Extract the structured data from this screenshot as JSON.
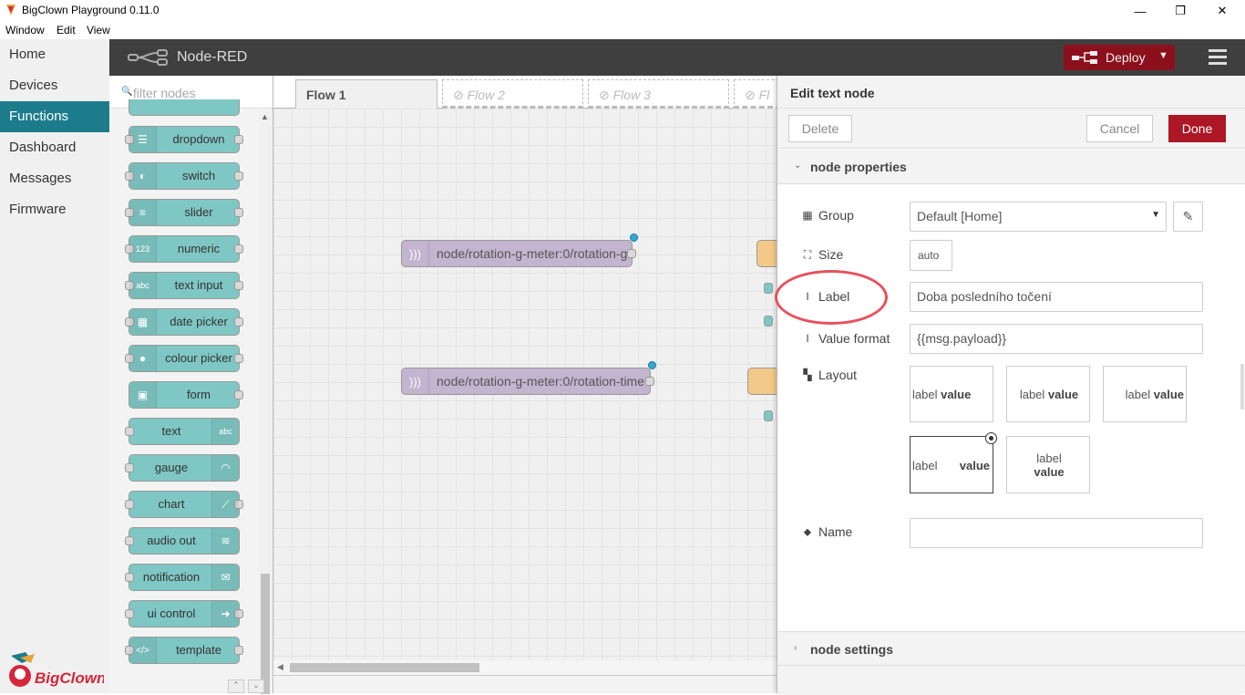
{
  "window": {
    "title": "BigClown Playground 0.11.0",
    "menu": [
      "Window",
      "Edit",
      "View"
    ],
    "minimize": "—",
    "maximize": "❐",
    "close": "✕"
  },
  "leftnav": {
    "items": [
      {
        "label": "Home",
        "active": false
      },
      {
        "label": "Devices",
        "active": false
      },
      {
        "label": "Functions",
        "active": true
      },
      {
        "label": "Dashboard",
        "active": false
      },
      {
        "label": "Messages",
        "active": false
      },
      {
        "label": "Firmware",
        "active": false
      }
    ],
    "logo_text": "BigClown",
    "accent": "#1c7c8c"
  },
  "header": {
    "title": "Node-RED",
    "deploy_label": "Deploy",
    "deploy_color": "#8c101c"
  },
  "palette": {
    "filter_placeholder": "filter nodes",
    "nodes": [
      {
        "label": "dropdown",
        "icon": "list-icon",
        "side": "left"
      },
      {
        "label": "switch",
        "icon": "toggle-icon",
        "side": "left"
      },
      {
        "label": "slider",
        "icon": "sliders-icon",
        "side": "left"
      },
      {
        "label": "numeric",
        "icon": "numeric-icon",
        "side": "left"
      },
      {
        "label": "text input",
        "icon": "abc-icon",
        "side": "left"
      },
      {
        "label": "date picker",
        "icon": "calendar-icon",
        "side": "left"
      },
      {
        "label": "colour picker",
        "icon": "palette-icon",
        "side": "left"
      },
      {
        "label": "form",
        "icon": "form-icon",
        "side": "left"
      },
      {
        "label": "text",
        "icon": "abc-icon",
        "side": "right"
      },
      {
        "label": "gauge",
        "icon": "gauge-icon",
        "side": "right"
      },
      {
        "label": "chart",
        "icon": "chart-icon",
        "side": "right"
      },
      {
        "label": "audio out",
        "icon": "audio-icon",
        "side": "right"
      },
      {
        "label": "notification",
        "icon": "envelope-icon",
        "side": "right"
      },
      {
        "label": "ui control",
        "icon": "arrow-icon",
        "side": "right"
      },
      {
        "label": "template",
        "icon": "code-icon",
        "side": "left"
      }
    ],
    "node_color": "#7fc7c4"
  },
  "workspace": {
    "tabs": [
      {
        "label": "Flow 1",
        "disabled": false
      },
      {
        "label": "Flow 2",
        "disabled": true
      },
      {
        "label": "Flow 3",
        "disabled": true
      },
      {
        "label": "Fl",
        "disabled": true
      }
    ],
    "flow_nodes": [
      {
        "label": "node/rotation-g-meter:0/rotation-g"
      },
      {
        "label": "node/rotation-g-meter:0/rotation-time"
      }
    ],
    "mqtt_color": "#c3b4cf"
  },
  "editor": {
    "title": "Edit text node",
    "delete_label": "Delete",
    "cancel_label": "Cancel",
    "done_label": "Done",
    "done_color": "#ad1625",
    "properties_section": "node properties",
    "settings_section": "node settings",
    "group_label": "Group",
    "group_value": "Default [Home]",
    "size_label": "Size",
    "size_value": "auto",
    "label_label": "Label",
    "label_value": "Doba posledního točení",
    "format_label": "Value format",
    "format_value": "{{msg.payload}}",
    "layout_label": "Layout",
    "layout_options": [
      {
        "label": "label",
        "value": "value"
      },
      {
        "label": "label",
        "value": "value"
      },
      {
        "label": "label",
        "value": "value"
      },
      {
        "label": "label",
        "value": "value",
        "selected": true
      },
      {
        "label": "label",
        "value": "value"
      }
    ],
    "name_label": "Name",
    "name_value": ""
  }
}
